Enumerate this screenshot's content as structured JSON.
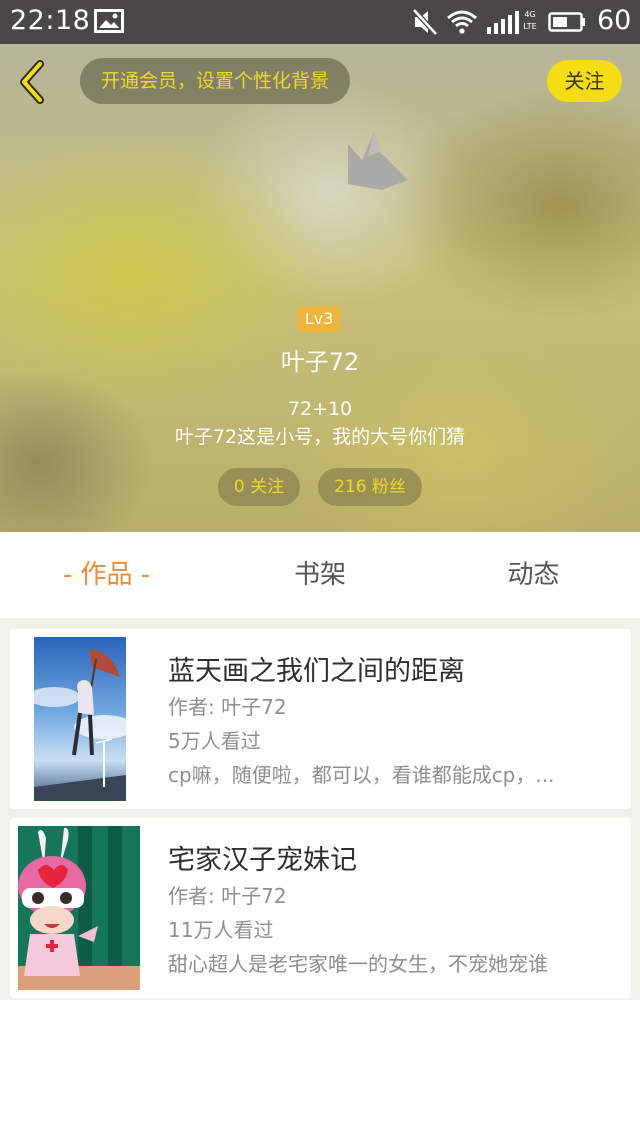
{
  "status_bar": {
    "time": "22:18",
    "network_label": "4G\nLTE",
    "battery": "60",
    "icons": [
      "image-icon",
      "mute-icon",
      "wifi-icon",
      "signal-icon",
      "battery-icon"
    ]
  },
  "header": {
    "vip_prompt": "开通会员，设置个性化背景",
    "follow_label": "关注",
    "level": "Lv3",
    "nickname": "叶子72",
    "signature_line1": "72+10",
    "signature_line2": "叶子72这是小号，我的大号你们猜",
    "following_label": "0 关注",
    "fans_label": "216 粉丝",
    "accent_color": "#f4dd12"
  },
  "tabs": [
    {
      "label": "- 作品 -",
      "active": true
    },
    {
      "label": "书架",
      "active": false
    },
    {
      "label": "动态",
      "active": false
    }
  ],
  "active_tab_color": "#ef8a3c",
  "works": [
    {
      "title": "蓝天画之我们之间的距离",
      "author": "作者: 叶子72",
      "views": "5万人看过",
      "description": "cp嘛，随便啦，都可以，看谁都能成cp，..."
    },
    {
      "title": "宅家汉子宠妹记",
      "author": "作者: 叶子72",
      "views": "11万人看过",
      "description": "甜心超人是老宅家唯一的女生，不宠她宠谁"
    }
  ]
}
